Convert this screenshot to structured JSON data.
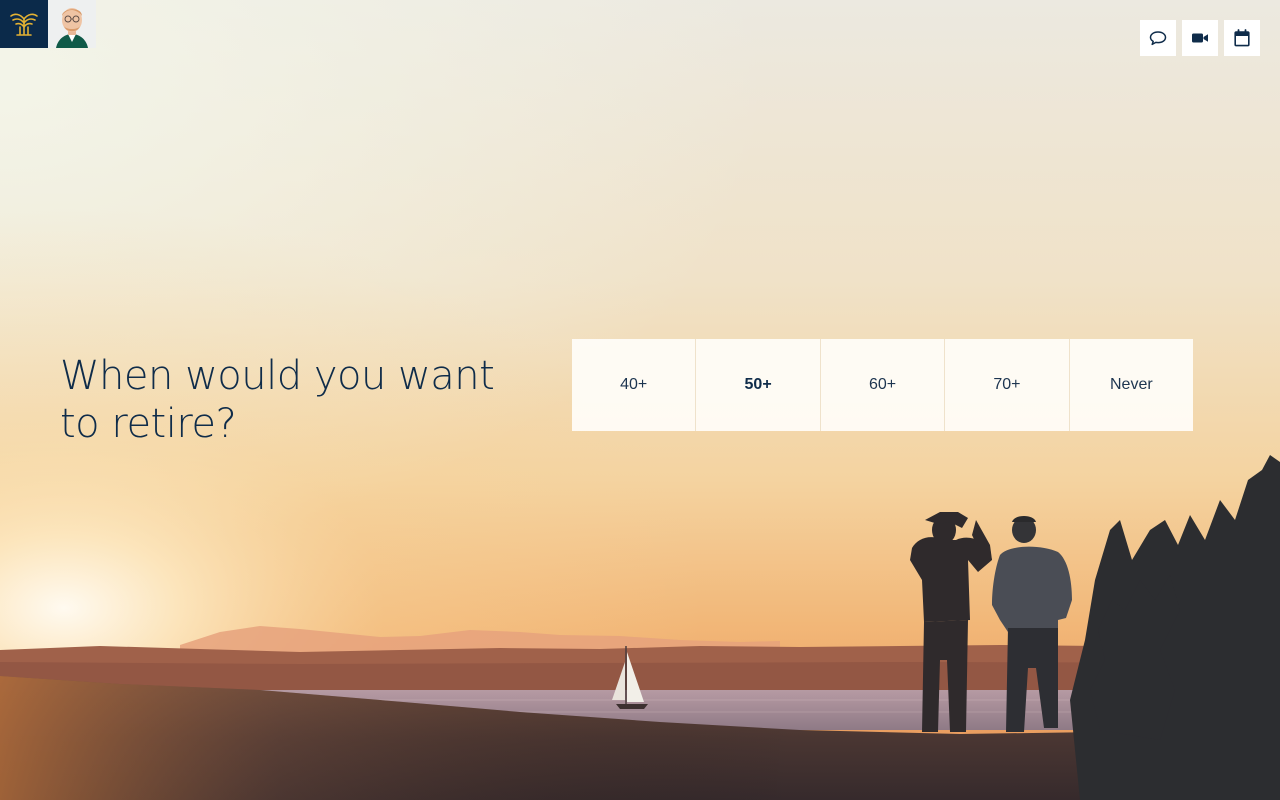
{
  "question": {
    "line1": "When would you want",
    "line2": "to retire?"
  },
  "options": [
    {
      "label": "40+",
      "selected": false
    },
    {
      "label": "50+",
      "selected": true
    },
    {
      "label": "60+",
      "selected": false
    },
    {
      "label": "70+",
      "selected": false
    },
    {
      "label": "Never",
      "selected": false
    }
  ],
  "actions": [
    {
      "icon": "chat-icon"
    },
    {
      "icon": "video-icon"
    },
    {
      "icon": "calendar-icon"
    }
  ],
  "colors": {
    "brand_navy": "#0b2a4a",
    "brand_gold": "#e4b233",
    "text_navy": "#0f2c4a"
  }
}
